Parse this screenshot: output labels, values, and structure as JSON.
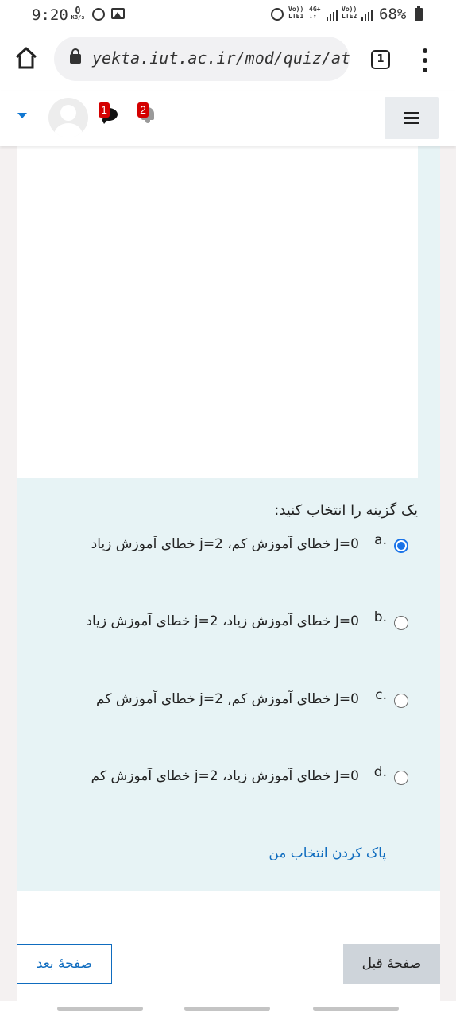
{
  "status_bar": {
    "time": "9:20",
    "speed_value": "0",
    "speed_unit": "KB/s",
    "sim1_label_top": "Vo))",
    "sim1_label_bottom": "LTE1",
    "network_label_top": "4G+",
    "network_label_bottom": "↓↑",
    "sim2_label_top": "Vo))",
    "sim2_label_bottom": "LTE2",
    "battery_percent": "68%"
  },
  "browser": {
    "url": "yekta.iut.ac.ir/mod/quiz/atte",
    "tab_count": "1"
  },
  "header": {
    "messages_badge": "1",
    "notifications_badge": "2"
  },
  "question": {
    "prompt": "یک گزینه را انتخاب کنید:",
    "options": [
      {
        "letter": "a.",
        "text": "J=0 خطای آموزش کم، j=2 خطای آموزش زیاد",
        "selected": true
      },
      {
        "letter": "b.",
        "text": "J=0 خطای آموزش زیاد، j=2 خطای آموزش زیاد",
        "selected": false
      },
      {
        "letter": "c.",
        "text": "J=0 خطای آموزش کم, j=2 خطای آموزش کم",
        "selected": false
      },
      {
        "letter": "d.",
        "text": "J=0 خطای آموزش زیاد، j=2 خطای آموزش کم",
        "selected": false
      }
    ],
    "clear_link": "پاک کردن انتخاب من"
  },
  "navigation": {
    "next_label": "صفحهٔ بعد",
    "prev_label": "صفحهٔ قبل"
  },
  "colors": {
    "question_bg": "#e7f3f5",
    "link": "#0f6cbf",
    "radio_selected": "#1a73e8",
    "badge": "#d40000"
  }
}
